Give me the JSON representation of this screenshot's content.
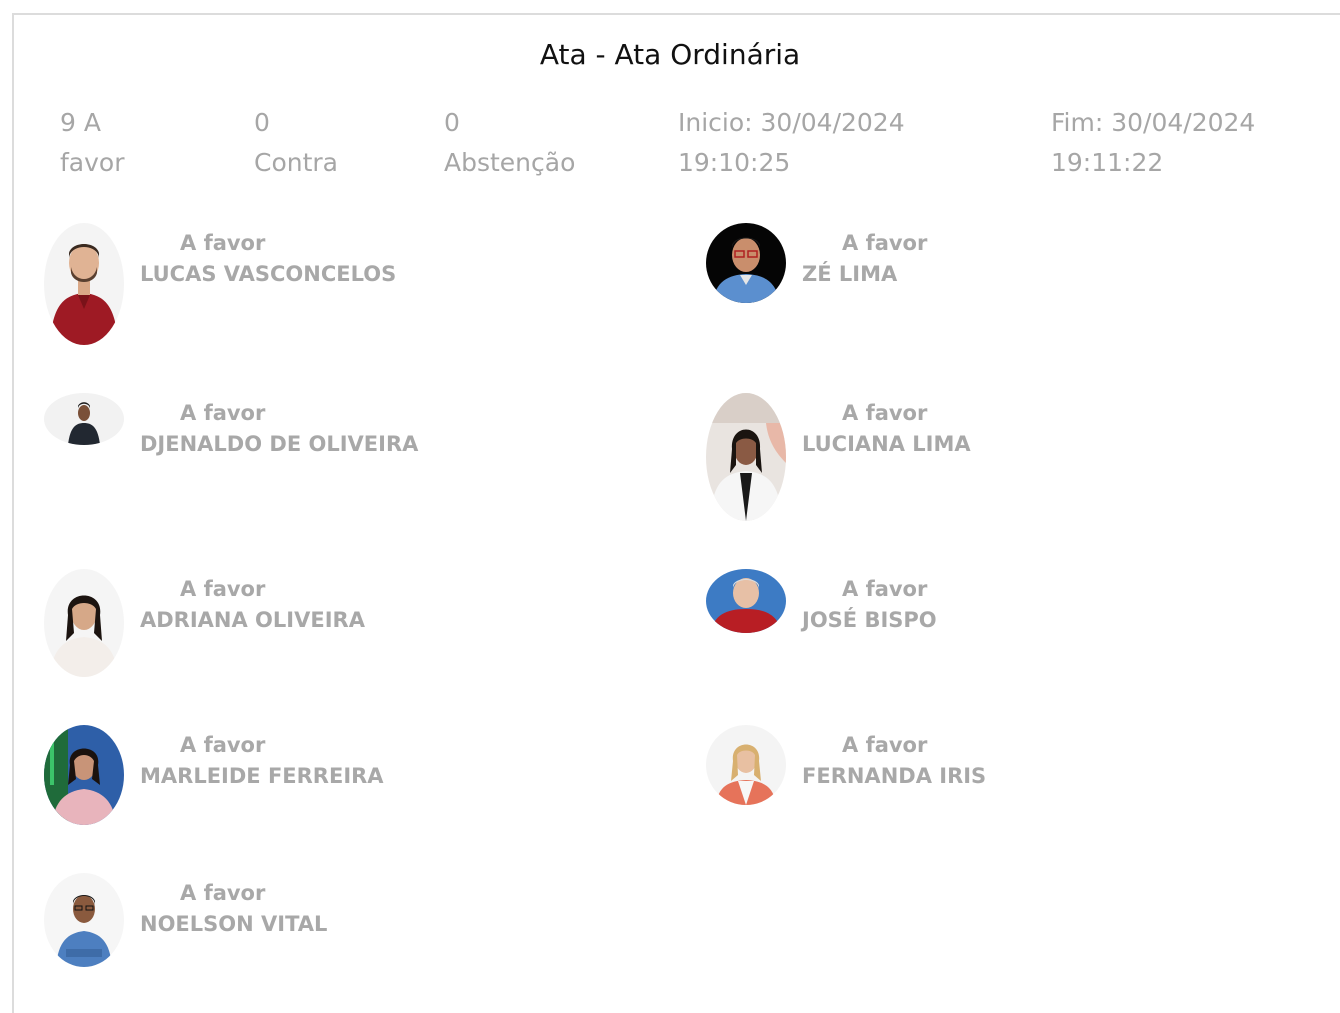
{
  "title": "Ata - Ata Ordinária",
  "stats": {
    "favor": {
      "value": "9 A",
      "label": "favor"
    },
    "contra": {
      "value": "0",
      "label": "Contra"
    },
    "abstencao": {
      "value": "0",
      "label": "Abstenção"
    },
    "inicio": {
      "value": "Inicio: 30/04/2024",
      "label": "19:10:25"
    },
    "fim": {
      "value": "Fim: 30/04/2024",
      "label": "19:11:22"
    }
  },
  "votes": [
    {
      "vote": "A favor",
      "name": "LUCAS VASCONCELOS",
      "photo": "man-red-shirt-white-bg"
    },
    {
      "vote": "A favor",
      "name": "ZÉ LIMA",
      "photo": "man-blue-shirt-black-bg"
    },
    {
      "vote": "A favor",
      "name": "DJENALDO DE OLIVEIRA",
      "photo": "man-dark-shirt-white-bg"
    },
    {
      "vote": "A favor",
      "name": "LUCIANA LIMA",
      "photo": "woman-white-blazer"
    },
    {
      "vote": "A favor",
      "name": "ADRIANA OLIVEIRA",
      "photo": "woman-white-blouse"
    },
    {
      "vote": "A favor",
      "name": "JOSÉ BISPO",
      "photo": "man-red-shirt-blue-bg"
    },
    {
      "vote": "A favor",
      "name": "MARLEIDE FERREIRA",
      "photo": "woman-pink-dress"
    },
    {
      "vote": "A favor",
      "name": "FERNANDA IRIS",
      "photo": "woman-coral-blazer"
    },
    {
      "vote": "A favor",
      "name": "NOELSON VITAL",
      "photo": "man-blue-shirt-white-bg"
    }
  ],
  "colors": {
    "text_muted": "#a6a6a6",
    "title": "#111111",
    "border": "#dcdcdc"
  }
}
